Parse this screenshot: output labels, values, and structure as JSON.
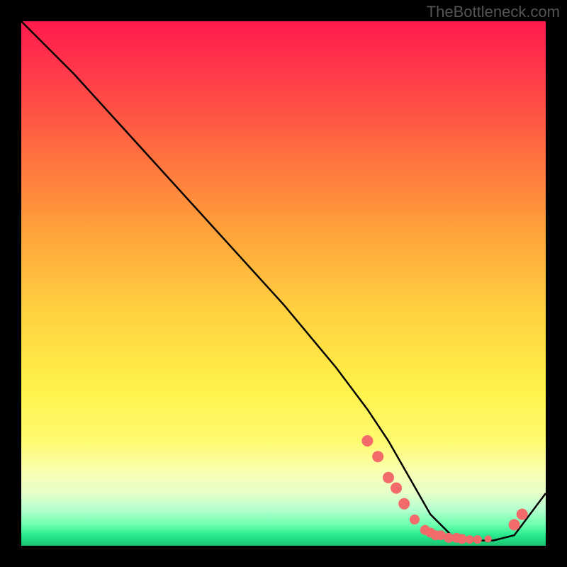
{
  "watermark": "TheBottleneck.com",
  "chart_data": {
    "type": "line",
    "title": "",
    "xlabel": "",
    "ylabel": "",
    "xlim": [
      0,
      100
    ],
    "ylim": [
      0,
      100
    ],
    "series": [
      {
        "name": "curve",
        "x": [
          0,
          6,
          10,
          20,
          30,
          40,
          50,
          60,
          66,
          70,
          74,
          78,
          82,
          86,
          90,
          94,
          100
        ],
        "y": [
          100,
          94,
          90,
          79,
          68,
          57,
          46,
          34,
          26,
          20,
          13,
          6,
          2,
          1,
          1,
          2,
          10
        ]
      }
    ],
    "markers": [
      {
        "name": "marker",
        "x": 66,
        "y": 20,
        "r": 8,
        "color": "#f26a6a"
      },
      {
        "name": "marker",
        "x": 68,
        "y": 17,
        "r": 8,
        "color": "#f26a6a"
      },
      {
        "name": "marker",
        "x": 70,
        "y": 13,
        "r": 8,
        "color": "#f26a6a"
      },
      {
        "name": "marker",
        "x": 71.5,
        "y": 11,
        "r": 8,
        "color": "#f26a6a"
      },
      {
        "name": "marker",
        "x": 73,
        "y": 8,
        "r": 8,
        "color": "#f26a6a"
      },
      {
        "name": "marker",
        "x": 75,
        "y": 5,
        "r": 7,
        "color": "#f26a6a"
      },
      {
        "name": "marker",
        "x": 77,
        "y": 3,
        "r": 7,
        "color": "#f26a6a"
      },
      {
        "name": "marker",
        "x": 78,
        "y": 2.5,
        "r": 7,
        "color": "#f26a6a"
      },
      {
        "name": "marker",
        "x": 79,
        "y": 2,
        "r": 7,
        "color": "#f26a6a"
      },
      {
        "name": "marker",
        "x": 80,
        "y": 2,
        "r": 7,
        "color": "#f26a6a"
      },
      {
        "name": "marker",
        "x": 81.5,
        "y": 1.5,
        "r": 7,
        "color": "#f26a6a"
      },
      {
        "name": "marker",
        "x": 83,
        "y": 1.5,
        "r": 7,
        "color": "#f26a6a"
      },
      {
        "name": "marker",
        "x": 84,
        "y": 1.3,
        "r": 7,
        "color": "#f26a6a"
      },
      {
        "name": "marker",
        "x": 85.5,
        "y": 1.2,
        "r": 6,
        "color": "#f26a6a"
      },
      {
        "name": "marker",
        "x": 87,
        "y": 1.2,
        "r": 6,
        "color": "#f26a6a"
      },
      {
        "name": "marker",
        "x": 89,
        "y": 1.3,
        "r": 5,
        "color": "#f26a6a"
      },
      {
        "name": "marker",
        "x": 94,
        "y": 4,
        "r": 8,
        "color": "#f26a6a"
      },
      {
        "name": "marker",
        "x": 95.5,
        "y": 6,
        "r": 8,
        "color": "#f26a6a"
      }
    ],
    "colors": {
      "line": "#000000",
      "marker": "#f26a6a",
      "gradient_top": "#ff1a4c",
      "gradient_bottom": "#19c46f"
    }
  }
}
